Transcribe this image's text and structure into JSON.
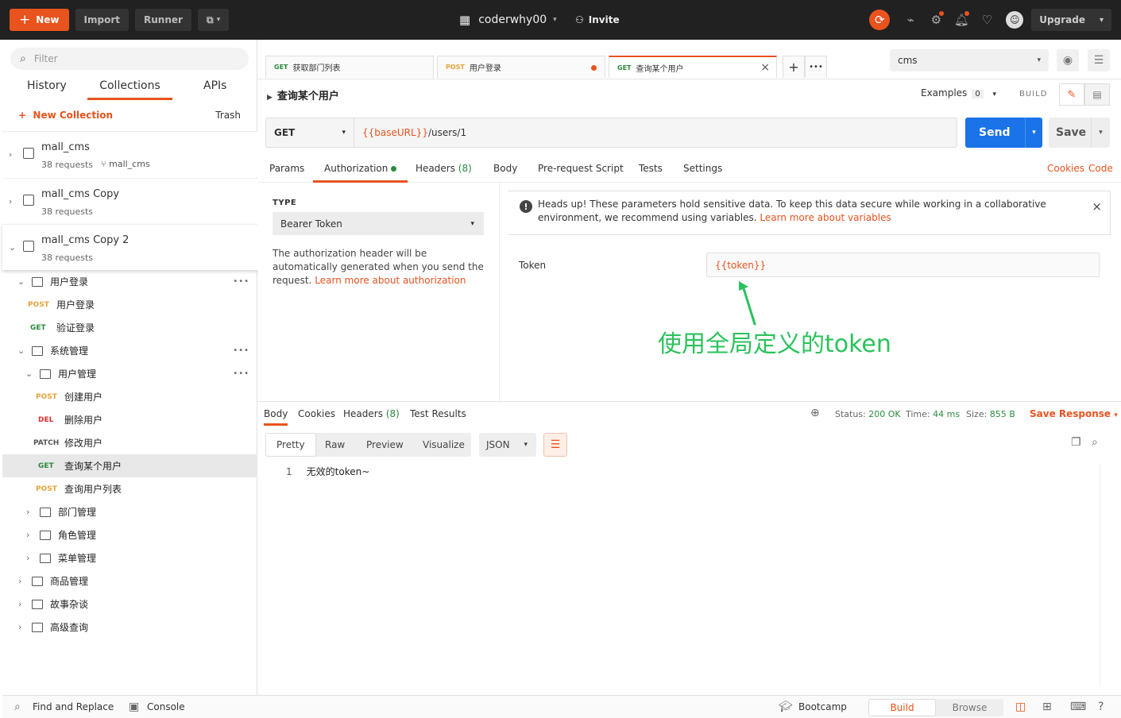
{
  "topbar": {
    "new_label": "New",
    "import_label": "Import",
    "runner_label": "Runner",
    "workspace": "coderwhy00",
    "invite_label": "Invite",
    "upgrade_label": "Upgrade"
  },
  "sidebar": {
    "filter_placeholder": "Filter",
    "tabs": [
      "History",
      "Collections",
      "APIs"
    ],
    "active_tab": "Collections",
    "new_collection_label": "New Collection",
    "trash_label": "Trash",
    "collections": [
      {
        "name": "mall_cms",
        "requests": "38 requests",
        "fork": "mall_cms"
      },
      {
        "name": "mall_cms Copy",
        "requests": "38 requests"
      },
      {
        "name": "mall_cms Copy 2",
        "requests": "38 requests"
      }
    ],
    "tree": [
      {
        "type": "folder",
        "label": "用户登录"
      },
      {
        "type": "request",
        "method": "POST",
        "label": "用户登录"
      },
      {
        "type": "request",
        "method": "GET",
        "label": "验证登录"
      },
      {
        "type": "folder",
        "label": "系统管理"
      },
      {
        "type": "folder",
        "label": "用户管理"
      },
      {
        "type": "request",
        "method": "POST",
        "label": "创建用户"
      },
      {
        "type": "request",
        "method": "DEL",
        "label": "删除用户"
      },
      {
        "type": "request",
        "method": "PATCH",
        "label": "修改用户"
      },
      {
        "type": "request",
        "method": "GET",
        "label": "查询某个用户"
      },
      {
        "type": "request",
        "method": "POST",
        "label": "查询用户列表"
      },
      {
        "type": "folder",
        "label": "部门管理"
      },
      {
        "type": "folder",
        "label": "角色管理"
      },
      {
        "type": "folder",
        "label": "菜单管理"
      },
      {
        "type": "folder",
        "label": "商品管理"
      },
      {
        "type": "folder",
        "label": "故事杂谈"
      },
      {
        "type": "folder",
        "label": "高级查询"
      }
    ]
  },
  "request_tabs": [
    {
      "method": "GET",
      "label": "获取部门列表"
    },
    {
      "method": "POST",
      "label": "用户登录"
    },
    {
      "method": "GET",
      "label": "查询某个用户"
    }
  ],
  "environment": "cms",
  "request": {
    "title": "查询某个用户",
    "examples_label": "Examples",
    "examples_count": "0",
    "build_label": "BUILD",
    "method": "GET",
    "url_var": "{{baseURL}}",
    "url_path": "/users/1",
    "send_label": "Send",
    "save_label": "Save",
    "tabs": [
      "Params",
      "Authorization",
      "Headers",
      "Body",
      "Pre-request Script",
      "Tests",
      "Settings"
    ],
    "headers_count": "(8)",
    "cookies_label": "Cookies",
    "code_label": "Code"
  },
  "auth": {
    "type_label": "TYPE",
    "type_value": "Bearer Token",
    "desc": "The authorization header will be automatically generated when you send the request.",
    "desc_link": "Learn more about authorization",
    "notice": "Heads up! These parameters hold sensitive data. To keep this data secure while working in a collaborative environment, we recommend using variables.",
    "notice_link": "Learn more about variables",
    "token_label": "Token",
    "token_value": "{{token}}",
    "annotation": "使用全局定义的token"
  },
  "response": {
    "tabs": [
      "Body",
      "Cookies",
      "Headers",
      "Test Results"
    ],
    "headers_count": "(8)",
    "status_label": "Status:",
    "status_value": "200 OK",
    "time_label": "Time:",
    "time_value": "44 ms",
    "size_label": "Size:",
    "size_value": "855 B",
    "save_response_label": "Save Response",
    "formats": [
      "Pretty",
      "Raw",
      "Preview",
      "Visualize"
    ],
    "language": "JSON",
    "line_number": "1",
    "body_text": "无效的token~"
  },
  "bottombar": {
    "find_replace": "Find and Replace",
    "console": "Console",
    "bootcamp": "Bootcamp",
    "build": "Build",
    "browse": "Browse"
  },
  "colors": {
    "accent": "#e8531e",
    "send": "#1a73e8",
    "success": "#2b8a3e",
    "annotation": "#2bc25c"
  }
}
